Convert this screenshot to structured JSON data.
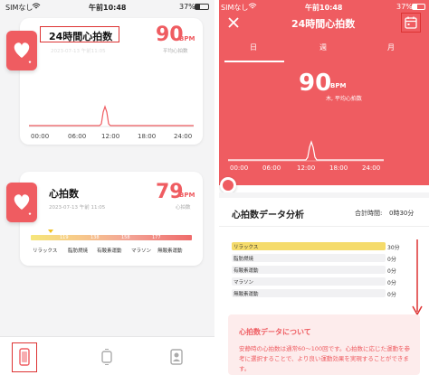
{
  "status_bar": {
    "carrier": "SIMなし",
    "time": "午前10:48",
    "battery": "37%"
  },
  "left": {
    "card1": {
      "title": "24時間心拍数",
      "value": "90",
      "unit": "BPM",
      "date": "2023-07-13 午前11:05",
      "avg_label": "平均心拍数",
      "x_ticks": [
        "00:00",
        "06:00",
        "12:00",
        "18:00",
        "24:00"
      ]
    },
    "card2": {
      "title": "心拍数",
      "value": "79",
      "unit": "BPM",
      "date": "2023-07-13 午前 11:05",
      "sub_label": "心拍数",
      "thresholds": [
        "119",
        "138",
        "158",
        "177"
      ],
      "zones": [
        "リラックス",
        "脂肪燃焼",
        "有酸素運動",
        "マラソン",
        "無酸素運動"
      ]
    },
    "tabs": [
      "heart-rate-tab-icon",
      "watch-tab-icon",
      "profile-tab-icon"
    ]
  },
  "right": {
    "header_title": "24時間心拍数",
    "tabs": [
      "日",
      "週",
      "月"
    ],
    "value": "90",
    "unit": "BPM",
    "sub_label": "木, 平均心拍数",
    "x_ticks": [
      "00:00",
      "06:00",
      "12:00",
      "18:00",
      "24:00"
    ],
    "analysis_title": "心拍数データ分析",
    "total_label": "合計時間:",
    "total_value": "0時30分",
    "zones": [
      {
        "label": "リラックス",
        "value": "30分",
        "fraction": 1.0
      },
      {
        "label": "脂肪燃焼",
        "value": "0分",
        "fraction": 0
      },
      {
        "label": "有酸素運動",
        "value": "0分",
        "fraction": 0
      },
      {
        "label": "マラソン",
        "value": "0分",
        "fraction": 0
      },
      {
        "label": "無酸素運動",
        "value": "0分",
        "fraction": 0
      }
    ],
    "about_title": "心拍数データについて",
    "about_text": "安静時の心拍数は通常60〜100回です。心拍数に応じた運動を参考に選択することで、より良い運動効果を実現することができます。"
  },
  "colors": {
    "accent": "#ef5c61",
    "relax_bar": "#f5db6b",
    "highlight": "#d33333"
  }
}
